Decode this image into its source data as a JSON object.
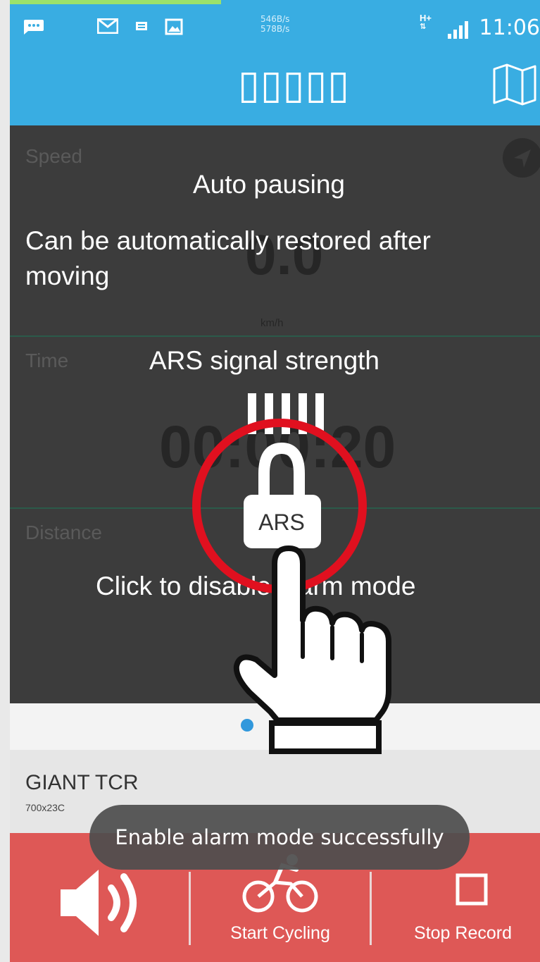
{
  "status_bar": {
    "net_up": "546B/s",
    "net_down": "578B/s",
    "network_type": "H+",
    "time": "11:06"
  },
  "header": {
    "title": "▯▯▯▯▯"
  },
  "panels": {
    "speed": {
      "label": "Speed",
      "value": "0.0",
      "unit": "km/h"
    },
    "time": {
      "label": "Time",
      "value": "00:00:20"
    },
    "distance": {
      "label": "Distance"
    }
  },
  "tutorial": {
    "auto_pause_title": "Auto pausing",
    "auto_pause_desc_line1": "Can be automatically restored after",
    "auto_pause_desc_line2": "moving",
    "signal_title": "ARS signal strength",
    "signal_bars": "▮▮▮▮▮",
    "lock_label": "ARS",
    "alarm_hint": "Click to disable alarm mode"
  },
  "bike": {
    "name": "GIANT TCR",
    "size": "700x23C"
  },
  "bottom_bar": {
    "start_label": "Start Cycling",
    "stop_label": "Stop Record"
  },
  "toast": {
    "message": "Enable alarm mode successfully"
  },
  "colors": {
    "header_blue": "#39ade2",
    "bottom_red": "#de5856",
    "highlight_red": "#e0101f",
    "pager_blue": "#3198dc"
  }
}
